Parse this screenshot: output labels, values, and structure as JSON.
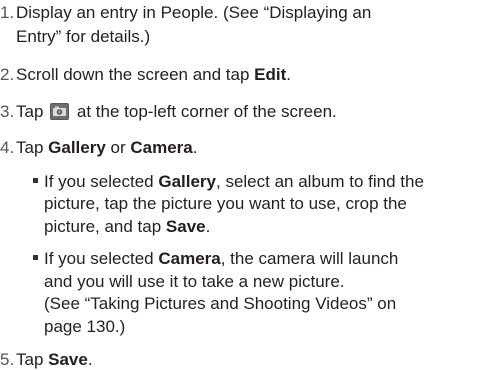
{
  "steps": {
    "s1": {
      "num": "1.",
      "line1": "Display an entry in People. (See “Displaying an",
      "line2": "Entry” for details.)"
    },
    "s2": {
      "num": "2.",
      "text": "Scroll down the screen and tap ",
      "bold": "Edit",
      "end": "."
    },
    "s3": {
      "num": "3.",
      "before": "Tap",
      "icon": "camera-icon",
      "after": "at the top-left corner of the screen."
    },
    "s4": {
      "num": "4.",
      "text": "Tap ",
      "bold1": "Gallery",
      "mid": " or ",
      "bold2": "Camera",
      "end": "."
    },
    "s5": {
      "num": "5.",
      "text": "Tap ",
      "bold": "Save",
      "end": "."
    }
  },
  "bullets": {
    "b1": {
      "line1_pre": "If you selected ",
      "line1_bold": "Gallery",
      "line1_post": ", select an album to find the",
      "line2": "picture, tap the picture you want to use, crop the",
      "line3_pre": "picture, and tap ",
      "line3_bold": "Save",
      "line3_post": "."
    },
    "b2": {
      "line1_pre": "If you selected ",
      "line1_bold": "Camera",
      "line1_post": ", the camera will launch",
      "line2": "and you will use it to take a new picture.",
      "line3": "(See “Taking Pictures and Shooting Videos” on",
      "line4": "page 130.)"
    }
  },
  "colors": {
    "text": "#231f20",
    "step_number": "#555555",
    "icon_bg": "#5a5a5a"
  }
}
